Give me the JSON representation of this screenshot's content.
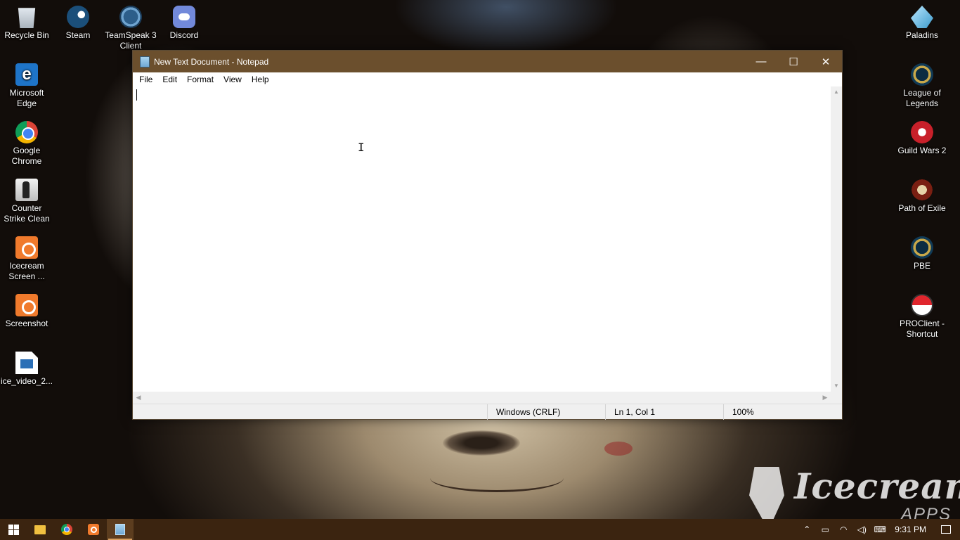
{
  "desktop": {
    "left_icons": [
      {
        "label": "Recycle Bin",
        "icon": "recycle-bin-icon"
      },
      {
        "label": "Microsoft Edge",
        "icon": "edge-icon"
      },
      {
        "label": "Google Chrome",
        "icon": "chrome-icon"
      },
      {
        "label": "Counter Strike Clean",
        "icon": "counter-strike-icon"
      },
      {
        "label": "Icecream Screen ...",
        "icon": "icecream-screen-recorder-icon"
      },
      {
        "label": "Screenshot",
        "icon": "screenshot-icon"
      },
      {
        "label": "ice_video_2...",
        "icon": "video-file-icon"
      }
    ],
    "top_icons": [
      {
        "label": "Steam",
        "icon": "steam-icon"
      },
      {
        "label": "TeamSpeak 3 Client",
        "icon": "teamspeak-icon"
      },
      {
        "label": "Discord",
        "icon": "discord-icon"
      }
    ],
    "right_icons": [
      {
        "label": "Paladins",
        "icon": "paladins-icon"
      },
      {
        "label": "League of Legends",
        "icon": "league-of-legends-icon"
      },
      {
        "label": "Guild Wars 2",
        "icon": "guild-wars-2-icon"
      },
      {
        "label": "Path of Exile",
        "icon": "path-of-exile-icon"
      },
      {
        "label": "PBE",
        "icon": "pbe-icon"
      },
      {
        "label": "PROClient - Shortcut",
        "icon": "proclient-icon"
      }
    ]
  },
  "notepad": {
    "title": "New Text Document - Notepad",
    "menu": [
      "File",
      "Edit",
      "Format",
      "View",
      "Help"
    ],
    "content": "",
    "status": {
      "line_ending": "Windows (CRLF)",
      "position": "Ln 1, Col 1",
      "zoom": "100%"
    },
    "controls": {
      "minimize": "—",
      "maximize": "☐",
      "close": "✕"
    }
  },
  "watermark": {
    "brand": "Icecream",
    "sub": "APPS"
  },
  "taskbar": {
    "apps": [
      "start-icon",
      "file-explorer-icon",
      "chrome-icon",
      "icecream-screen-recorder-icon",
      "notepad-icon"
    ],
    "active": "notepad-icon",
    "time": "9:31 PM"
  },
  "colors": {
    "titlebar": "#6b4f2d",
    "taskbar": "#3b2410",
    "accent": "#d7a060"
  }
}
